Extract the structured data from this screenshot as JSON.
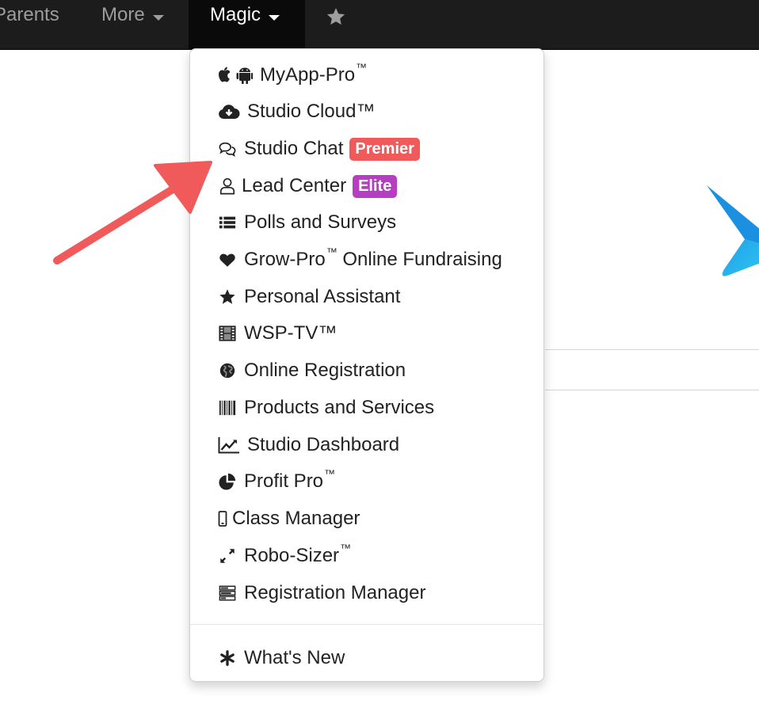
{
  "navbar": {
    "items": [
      {
        "label": "Parents"
      },
      {
        "label": "More"
      },
      {
        "label": "Magic"
      }
    ]
  },
  "menu": {
    "items": [
      {
        "label": "MyApp-Pro",
        "suffix": "™",
        "icon": "apple-android-icon"
      },
      {
        "label": "Studio Cloud™",
        "icon": "cloud-download-icon"
      },
      {
        "label": "Studio Chat",
        "icon": "comments-icon",
        "badge": "Premier",
        "badge_color": "#f05a5a"
      },
      {
        "label": "Lead Center",
        "icon": "user-outline-icon",
        "badge": "Elite",
        "badge_color": "#b43fc0"
      },
      {
        "label": "Polls and Surveys",
        "icon": "list-icon"
      },
      {
        "label": "Grow-Pro",
        "suffix": "™",
        "label_after": " Online Fundraising",
        "icon": "heart-icon"
      },
      {
        "label": "Personal Assistant",
        "icon": "star-icon"
      },
      {
        "label": "WSP-TV™",
        "icon": "film-icon"
      },
      {
        "label": "Online Registration",
        "icon": "globe-icon"
      },
      {
        "label": "Products and Services",
        "icon": "barcode-icon"
      },
      {
        "label": "Studio Dashboard",
        "icon": "line-chart-icon"
      },
      {
        "label": "Profit Pro",
        "suffix": "™",
        "icon": "pie-chart-icon"
      },
      {
        "label": "Class Manager",
        "icon": "mobile-icon"
      },
      {
        "label": "Robo-Sizer",
        "suffix": "™",
        "icon": "expand-icon"
      },
      {
        "label": "Registration Manager",
        "icon": "tasks-icon"
      }
    ],
    "footer_item": {
      "label": "What's New",
      "icon": "asterisk-icon"
    }
  },
  "colors": {
    "navbar_bg": "#1c1c1c",
    "premier_badge": "#f05a5a",
    "elite_badge": "#b43fc0",
    "annotation_arrow": "#f05a5a"
  }
}
